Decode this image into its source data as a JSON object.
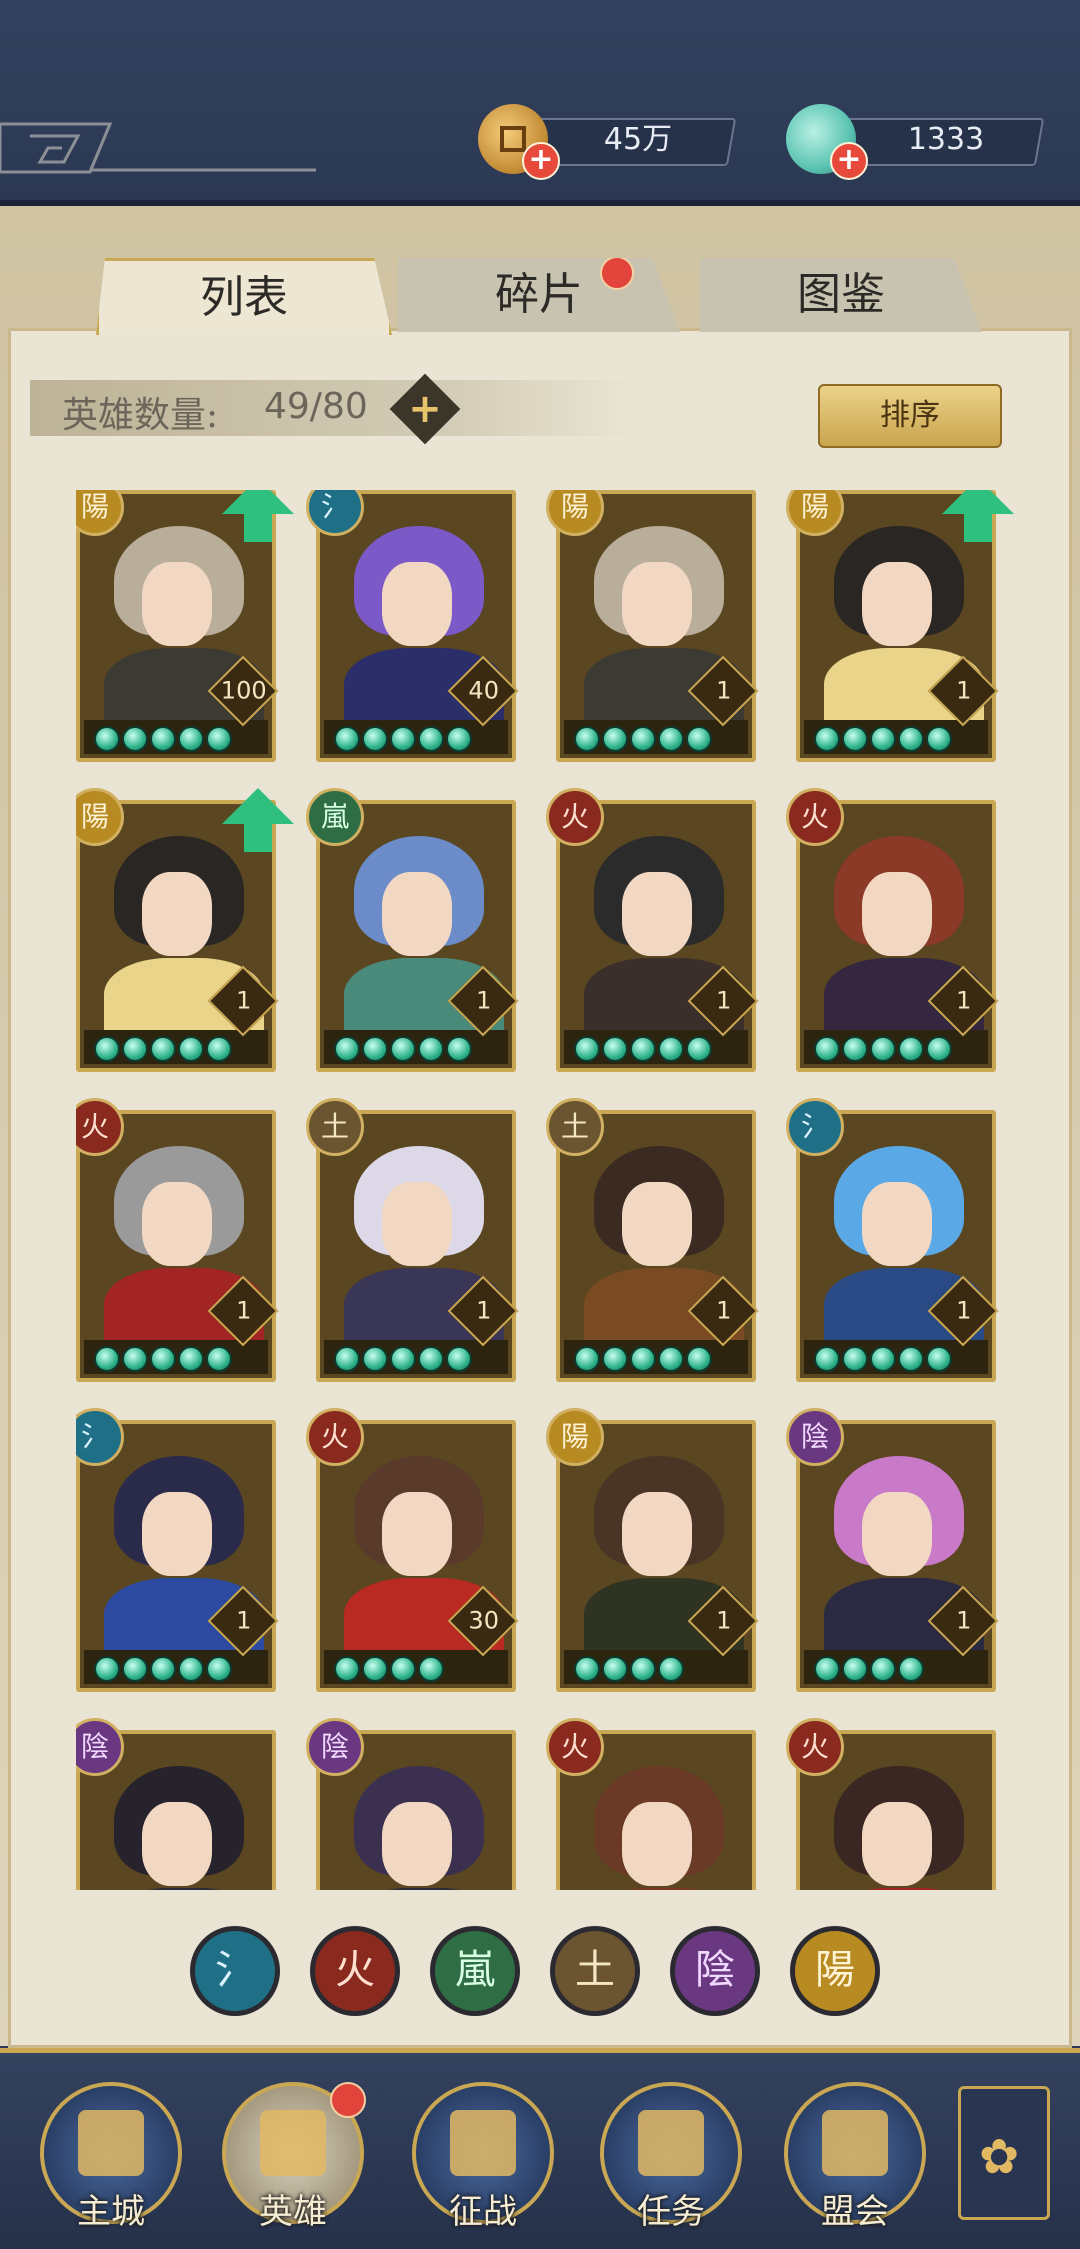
{
  "resources": {
    "coins": {
      "value": "45万",
      "icon": "coin-icon"
    },
    "shells": {
      "value": "1333",
      "icon": "shell-icon"
    }
  },
  "tabs": [
    {
      "label": "列表",
      "active": true
    },
    {
      "label": "碎片",
      "active": false,
      "has_alert": true
    },
    {
      "label": "图鉴",
      "active": false
    }
  ],
  "hero_count": {
    "label": "英雄数量:",
    "value": "49/80"
  },
  "sort_button": "排序",
  "heroes": [
    {
      "element": "陽",
      "element_class": "e-yang",
      "level": "100",
      "stars": 5,
      "upgrade": true,
      "hair": "#b8ae9a",
      "body": "#3b3a33"
    },
    {
      "element": "氵",
      "element_class": "e-shui",
      "level": "40",
      "stars": 5,
      "upgrade": false,
      "hair": "#7b5ac8",
      "body": "#2b2e68"
    },
    {
      "element": "陽",
      "element_class": "e-yang",
      "level": "1",
      "stars": 5,
      "upgrade": false,
      "hair": "#b8ae9a",
      "body": "#3b3a33"
    },
    {
      "element": "陽",
      "element_class": "e-yang",
      "level": "1",
      "stars": 5,
      "upgrade": true,
      "hair": "#2a2624",
      "body": "#e9d48a"
    },
    {
      "element": "陽",
      "element_class": "e-yang",
      "level": "1",
      "stars": 5,
      "upgrade": true,
      "hair": "#2a2624",
      "body": "#e9d48a"
    },
    {
      "element": "嵐",
      "element_class": "e-feng",
      "level": "1",
      "stars": 5,
      "upgrade": false,
      "hair": "#6c8bc9",
      "body": "#4a8a7a"
    },
    {
      "element": "火",
      "element_class": "e-huo",
      "level": "1",
      "stars": 5,
      "upgrade": false,
      "hair": "#2b2b2b",
      "body": "#3a2f2a"
    },
    {
      "element": "火",
      "element_class": "e-huo",
      "level": "1",
      "stars": 5,
      "upgrade": false,
      "hair": "#8a3a26",
      "body": "#34273f"
    },
    {
      "element": "火",
      "element_class": "e-huo",
      "level": "1",
      "stars": 5,
      "upgrade": false,
      "hair": "#9a9a9a",
      "body": "#a32424"
    },
    {
      "element": "土",
      "element_class": "e-tu",
      "level": "1",
      "stars": 5,
      "upgrade": false,
      "hair": "#dcd8e8",
      "body": "#3a3656"
    },
    {
      "element": "土",
      "element_class": "e-tu",
      "level": "1",
      "stars": 5,
      "upgrade": false,
      "hair": "#3a2a22",
      "body": "#7a4a22"
    },
    {
      "element": "氵",
      "element_class": "e-shui",
      "level": "1",
      "stars": 5,
      "upgrade": false,
      "hair": "#5aa8e6",
      "body": "#2a4a86"
    },
    {
      "element": "氵",
      "element_class": "e-shui",
      "level": "1",
      "stars": 5,
      "upgrade": false,
      "hair": "#2a2a4a",
      "body": "#2b4aa0"
    },
    {
      "element": "火",
      "element_class": "e-huo",
      "level": "30",
      "stars": 4,
      "upgrade": false,
      "hair": "#5a3a2a",
      "body": "#b82a22"
    },
    {
      "element": "陽",
      "element_class": "e-yang",
      "level": "1",
      "stars": 4,
      "upgrade": false,
      "hair": "#4a3426",
      "body": "#2e3322"
    },
    {
      "element": "陰",
      "element_class": "e-yin",
      "level": "1",
      "stars": 4,
      "upgrade": false,
      "hair": "#c879c8",
      "body": "#2a2a42"
    },
    {
      "element": "陰",
      "element_class": "e-yin",
      "level": "",
      "stars": 0,
      "upgrade": false,
      "hair": "#26232c",
      "body": "#2a2a3a"
    },
    {
      "element": "陰",
      "element_class": "e-yin",
      "level": "",
      "stars": 0,
      "upgrade": false,
      "hair": "#3c3050",
      "body": "#2a2a3a"
    },
    {
      "element": "火",
      "element_class": "e-huo",
      "level": "",
      "stars": 0,
      "upgrade": false,
      "hair": "#6a3a26",
      "body": "#7a3a22"
    },
    {
      "element": "火",
      "element_class": "e-huo",
      "level": "",
      "stars": 0,
      "upgrade": false,
      "hair": "#3a2622",
      "body": "#a32424"
    }
  ],
  "element_filters": [
    {
      "glyph": "氵",
      "class": "e-shui"
    },
    {
      "glyph": "火",
      "class": "e-huo"
    },
    {
      "glyph": "嵐",
      "class": "e-feng"
    },
    {
      "glyph": "土",
      "class": "e-tu"
    },
    {
      "glyph": "陰",
      "class": "e-yin"
    },
    {
      "glyph": "陽",
      "class": "e-yang"
    }
  ],
  "nav": [
    {
      "label": "主城",
      "icon": "city-icon",
      "active": false
    },
    {
      "label": "英雄",
      "icon": "hero-icon",
      "active": true,
      "has_alert": true
    },
    {
      "label": "征战",
      "icon": "battle-icon",
      "active": false
    },
    {
      "label": "任务",
      "icon": "quest-icon",
      "active": false
    },
    {
      "label": "盟会",
      "icon": "guild-icon",
      "active": false
    }
  ]
}
